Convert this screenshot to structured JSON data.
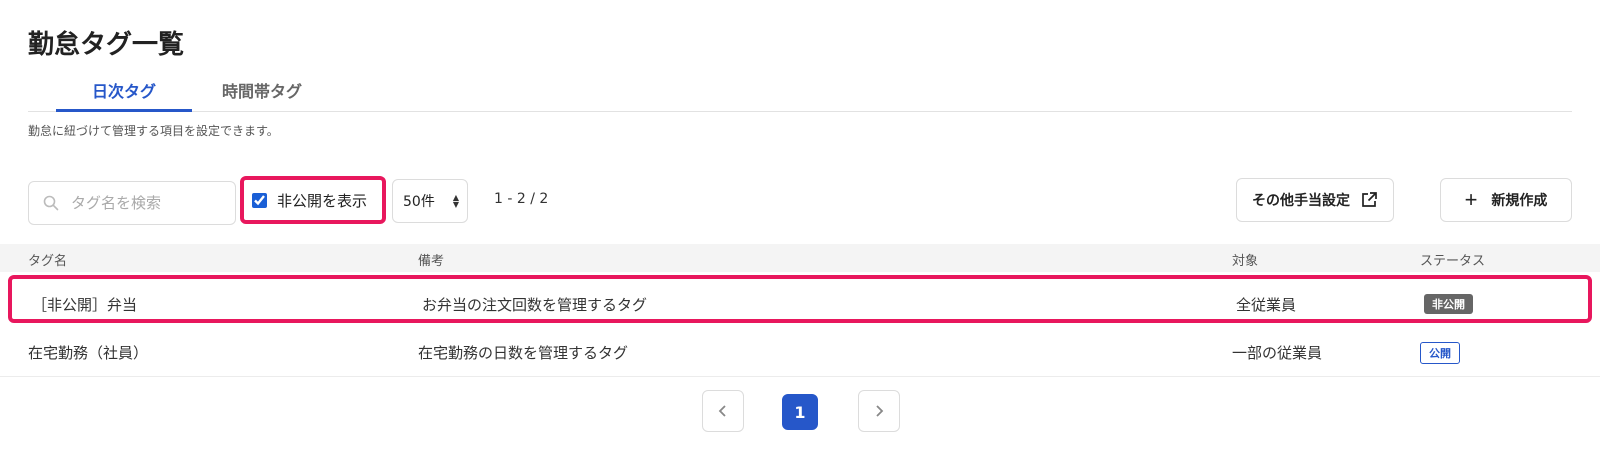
{
  "page": {
    "title": "勤怠タグ一覧",
    "description": "勤怠に紐づけて管理する項目を設定できます。"
  },
  "tabs": [
    {
      "label": "日次タグ",
      "active": true
    },
    {
      "label": "時間帯タグ",
      "active": false
    }
  ],
  "toolbar": {
    "search_placeholder": "タグ名を検索",
    "search_value": "",
    "show_hidden_label": "非公開を表示",
    "show_hidden_checked": true,
    "per_page": "50件",
    "range": "1 - 2 / 2",
    "other_allowance_label": "その他手当設定",
    "new_label": "新規作成"
  },
  "table": {
    "headers": {
      "name": "タグ名",
      "note": "備考",
      "target": "対象",
      "status": "ステータス"
    },
    "rows": [
      {
        "name": "［非公開］弁当",
        "note": "お弁当の注文回数を管理するタグ",
        "target": "全従業員",
        "status": "非公開"
      },
      {
        "name": "在宅勤務（社員）",
        "note": "在宅勤務の日数を管理するタグ",
        "target": "一部の従業員",
        "status": "公開"
      }
    ]
  },
  "pagination": {
    "current": "1"
  },
  "colors": {
    "accent": "#2657c9",
    "highlight": "#e8175d",
    "private_badge": "#666666"
  },
  "icons": [
    "search-icon",
    "external-link-icon",
    "plus-icon",
    "chevron-left-icon",
    "chevron-right-icon"
  ]
}
